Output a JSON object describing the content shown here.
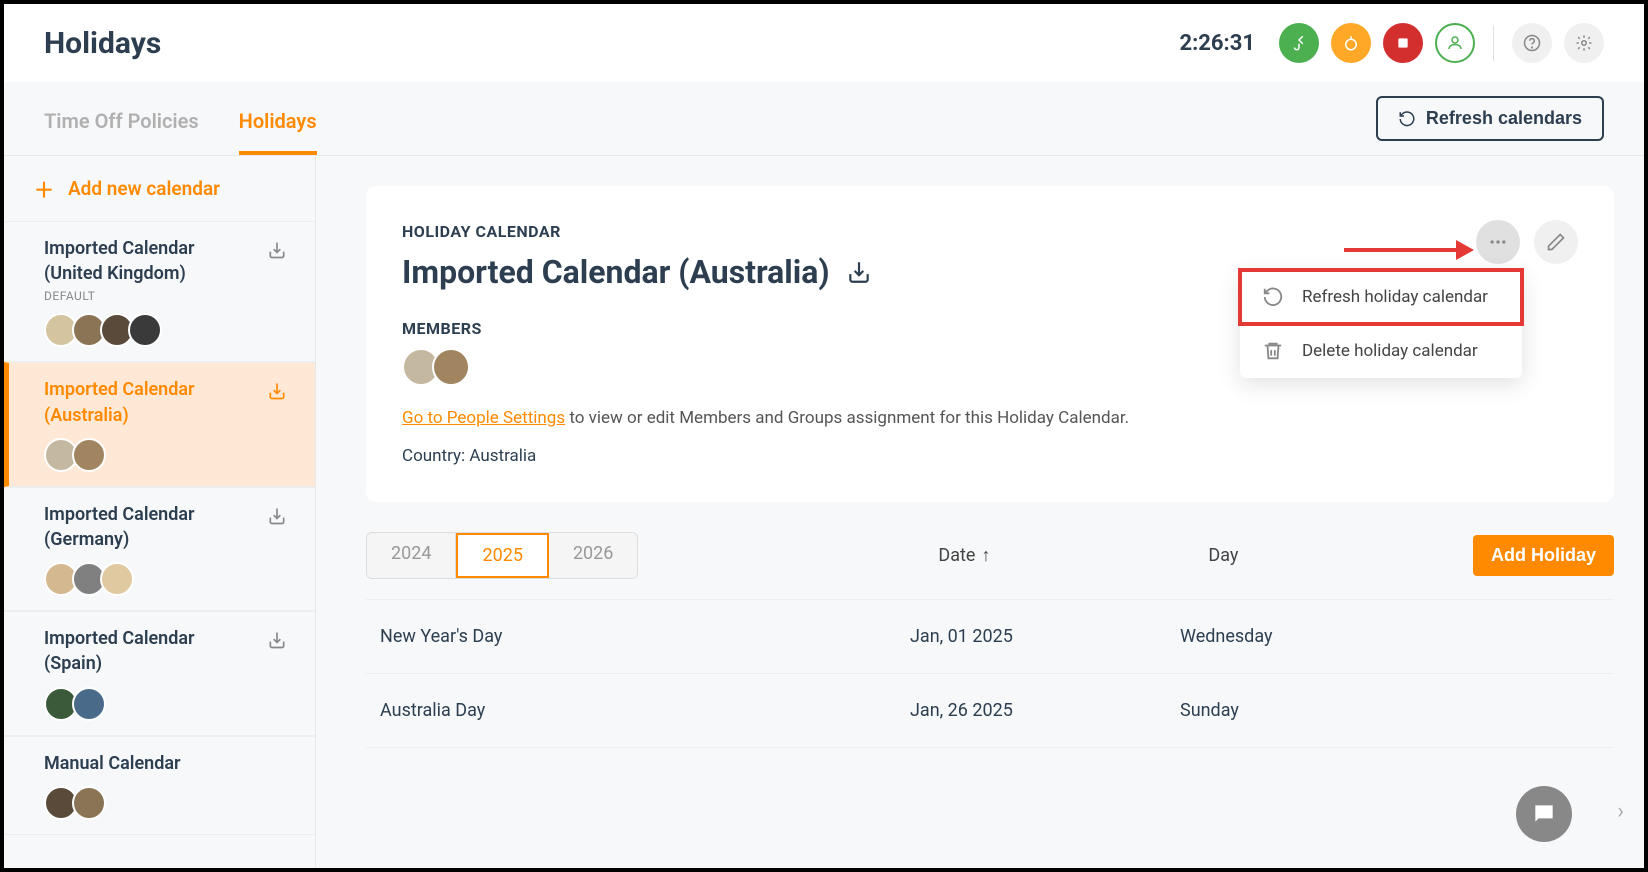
{
  "header": {
    "title": "Holidays",
    "time": "2:26:31"
  },
  "tabs": {
    "timeoff": "Time Off Policies",
    "holidays": "Holidays",
    "refresh_btn": "Refresh calendars"
  },
  "sidebar": {
    "add_label": "Add new calendar",
    "items": [
      {
        "name": "Imported Calendar (United Kingdom)",
        "default_tag": "DEFAULT"
      },
      {
        "name": "Imported Calendar (Australia)"
      },
      {
        "name": "Imported Calendar (Germany)"
      },
      {
        "name": "Imported Calendar (Spain)"
      },
      {
        "name": "Manual Calendar"
      }
    ]
  },
  "card": {
    "label": "HOLIDAY CALENDAR",
    "title": "Imported Calendar (Australia)",
    "members_label": "MEMBERS",
    "cta_link": "Go to People Settings",
    "cta_rest": " to view or edit Members and Groups assignment for this Holiday Calendar.",
    "country_label": "Country: Australia"
  },
  "dropdown": {
    "refresh": "Refresh holiday calendar",
    "delete": "Delete holiday calendar"
  },
  "years": {
    "y2024": "2024",
    "y2025": "2025",
    "y2026": "2026"
  },
  "cols": {
    "date": "Date",
    "day": "Day",
    "add_btn": "Add Holiday"
  },
  "holidays": [
    {
      "name": "New Year's Day",
      "date": "Jan, 01 2025",
      "day": "Wednesday"
    },
    {
      "name": "Australia Day",
      "date": "Jan, 26 2025",
      "day": "Sunday"
    }
  ]
}
